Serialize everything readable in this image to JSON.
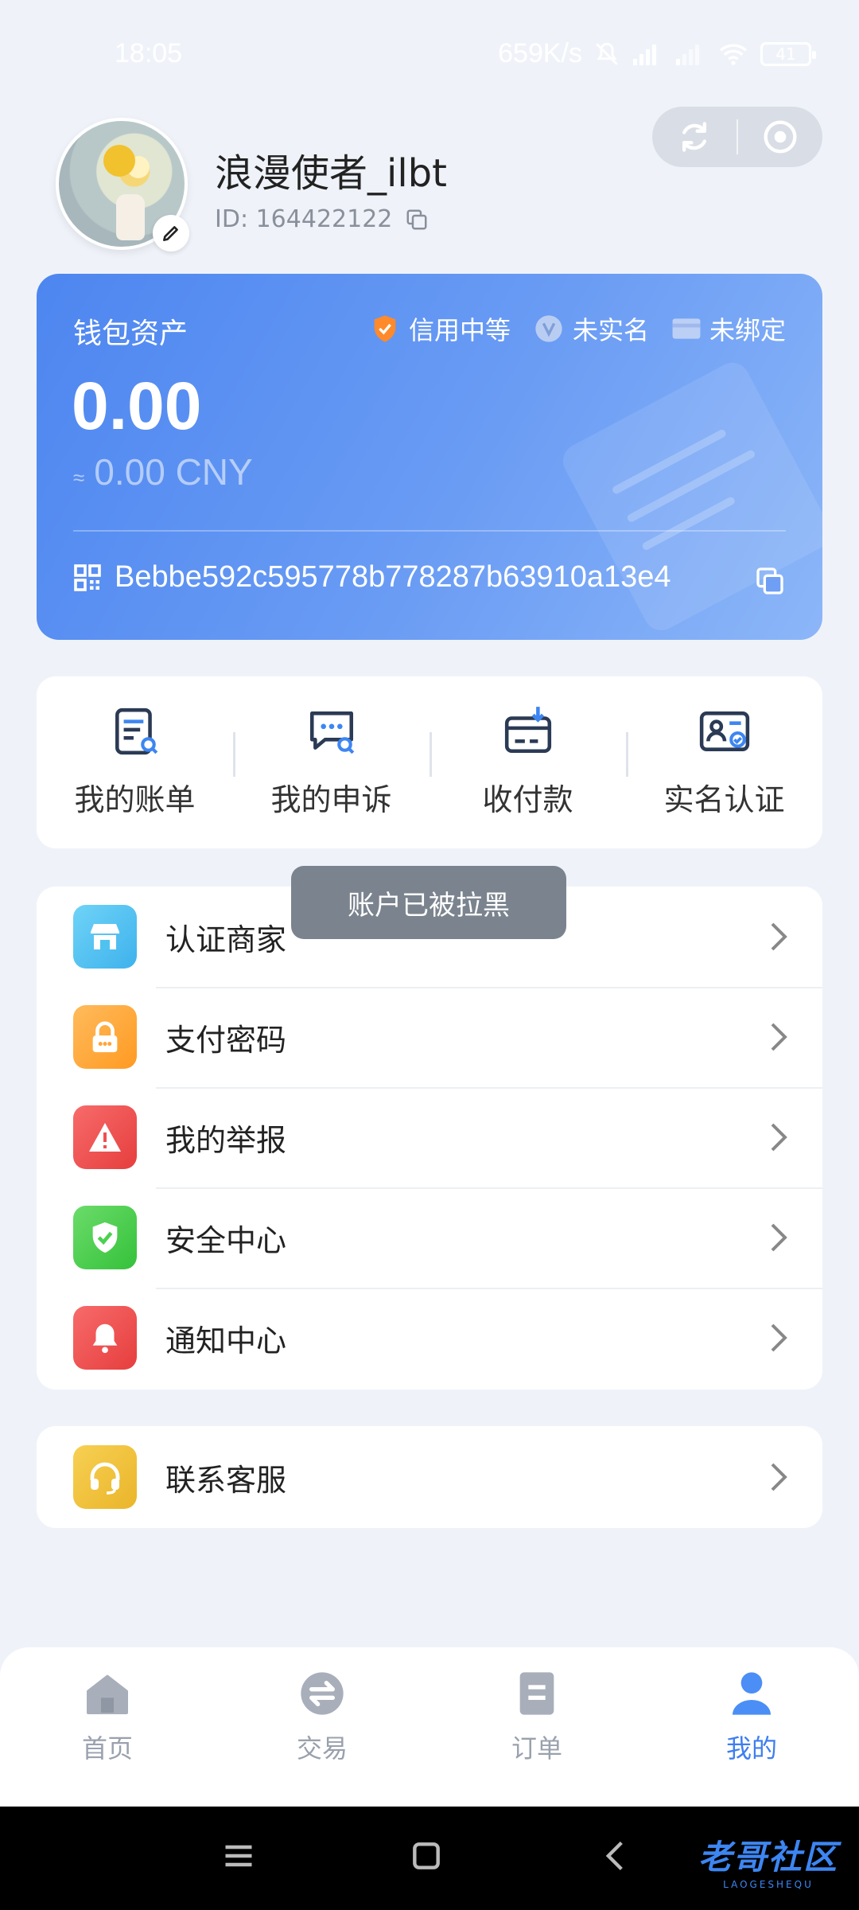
{
  "status_bar": {
    "time": "18:05",
    "net_speed": "659K/s",
    "battery": "41"
  },
  "profile": {
    "username": "浪漫使者_ilbt",
    "id_text": "ID: 164422122"
  },
  "wallet": {
    "title": "钱包资产",
    "credit_badge": "信用中等",
    "realname_badge": "未实名",
    "bind_badge": "未绑定",
    "amount": "0.00",
    "approx_symbol": "≈",
    "cny_amount": "0.00 CNY",
    "address": "Bebbe592c595778b778287b63910a13e4"
  },
  "quick_actions": [
    {
      "label": "我的账单",
      "icon": "bill-icon"
    },
    {
      "label": "我的申诉",
      "icon": "appeal-icon"
    },
    {
      "label": "收付款",
      "icon": "payment-icon"
    },
    {
      "label": "实名认证",
      "icon": "id-verify-icon"
    }
  ],
  "toast": "账户已被拉黑",
  "menu": [
    {
      "label": "认证商家",
      "icon": "store-icon",
      "color": "#4fc3f0"
    },
    {
      "label": "支付密码",
      "icon": "lock-icon",
      "color": "#ffa53a"
    },
    {
      "label": "我的举报",
      "icon": "warning-icon",
      "color": "#f0504f"
    },
    {
      "label": "安全中心",
      "icon": "shield-icon",
      "color": "#4bd14f"
    },
    {
      "label": "通知中心",
      "icon": "bell-icon",
      "color": "#f0504f"
    }
  ],
  "service": {
    "label": "联系客服",
    "icon": "headset-icon",
    "color": "#f2c43b"
  },
  "tabbar": [
    {
      "label": "首页",
      "icon": "home-icon",
      "active": false
    },
    {
      "label": "交易",
      "icon": "exchange-icon",
      "active": false
    },
    {
      "label": "订单",
      "icon": "order-icon",
      "active": false
    },
    {
      "label": "我的",
      "icon": "user-icon",
      "active": true
    }
  ],
  "watermark": {
    "main": "老哥社区",
    "sub": "LAOGESHEQU"
  },
  "colors": {
    "accent": "#3d7ef0",
    "background": "#eff3f9"
  }
}
